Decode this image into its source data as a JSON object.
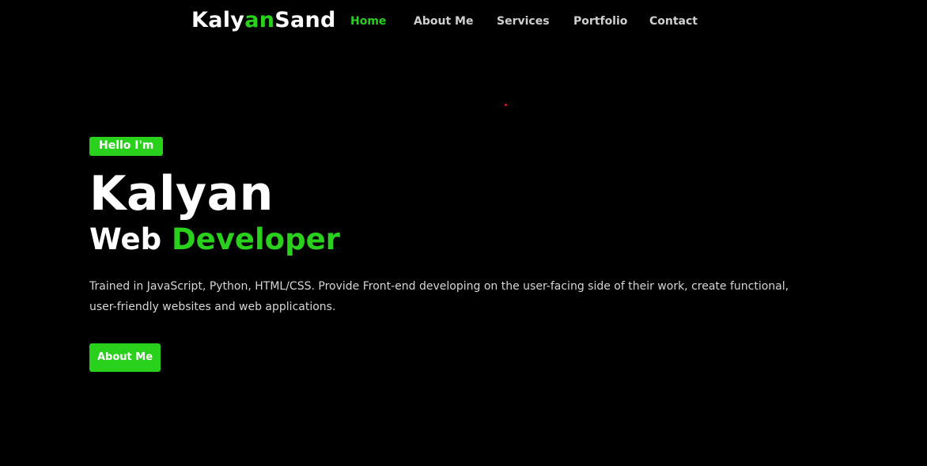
{
  "brand": {
    "logo_part1": "Kaly",
    "logo_accent": "an",
    "logo_part2": "Sand"
  },
  "nav": {
    "items": [
      {
        "label": "Home",
        "active": true
      },
      {
        "label": "About Me",
        "active": false
      },
      {
        "label": "Services",
        "active": false
      },
      {
        "label": "Portfolio",
        "active": false
      },
      {
        "label": "Contact",
        "active": false
      }
    ]
  },
  "hero": {
    "badge": "Hello I'm",
    "name": "Kalyan",
    "role_prefix": "Web",
    "role_accent": "Developer",
    "description": "Trained in JavaScript, Python, HTML/CSS. Provide Front-end developing on the user-facing side of their work, create functional, user-friendly websites and web applications.",
    "cta_label": "About Me"
  },
  "colors": {
    "background": "#000000",
    "accent": "#29d01c",
    "text": "#ffffff",
    "muted_text": "#d6d6d6"
  }
}
